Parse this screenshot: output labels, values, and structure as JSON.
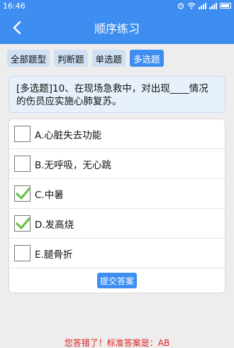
{
  "status": {
    "time": "16:46"
  },
  "header": {
    "title": "顺序练习",
    "back_icon": "chevron-left-icon"
  },
  "tabs": [
    {
      "label": "全部题型",
      "active": false
    },
    {
      "label": "判断题",
      "active": false
    },
    {
      "label": "单选题",
      "active": false
    },
    {
      "label": "多选题",
      "active": true
    }
  ],
  "question": {
    "text": "[多选题]10、在现场急救中，对出现____情况的伤员应实施心肺复苏。"
  },
  "options": [
    {
      "label": "A.心脏失去功能",
      "checked": false
    },
    {
      "label": "B.无呼吸，无心跳",
      "checked": false
    },
    {
      "label": "C.中暑",
      "checked": true
    },
    {
      "label": "D.发高烧",
      "checked": true
    },
    {
      "label": "E.腿骨折",
      "checked": false
    }
  ],
  "submit_label": "提交答案",
  "result_text": "您答错了！标准答案是：AB",
  "colors": {
    "primary": "#3d8ef0",
    "check": "#6cc04a",
    "error": "#e02020"
  }
}
